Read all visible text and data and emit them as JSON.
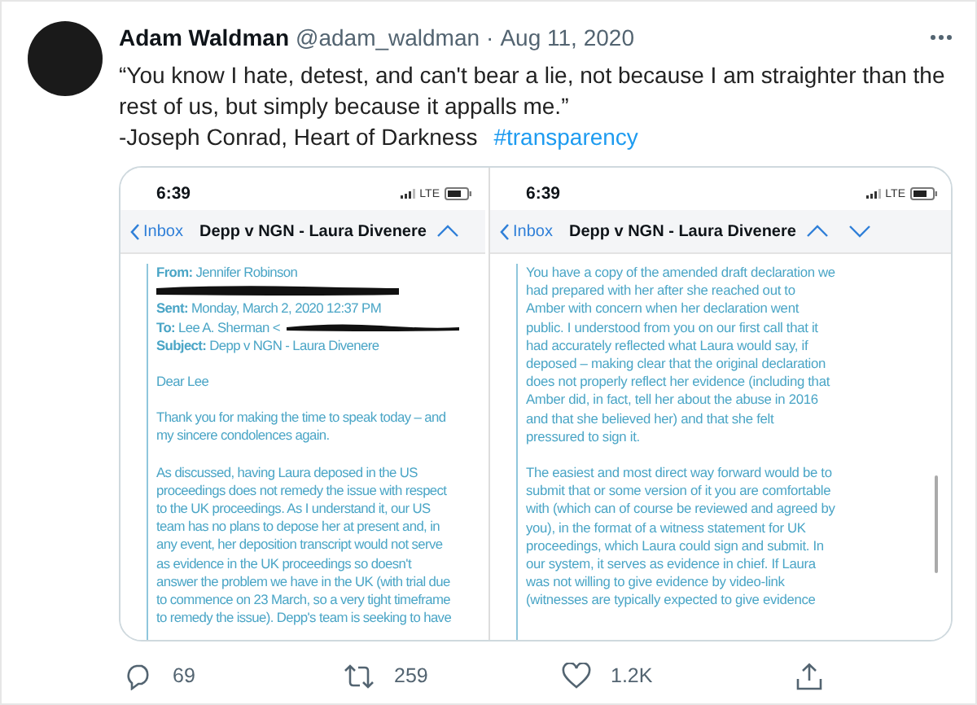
{
  "tweet": {
    "author": "Adam Waldman",
    "handle": "@adam_waldman",
    "separator": "·",
    "date": "Aug 11, 2020",
    "quote": "“You know I hate, detest, and can't bear a lie, not because I am straighter than the rest of us, but simply because it appalls me.”",
    "attribution": "-Joseph Conrad, Heart of Darkness",
    "hashtag": "#transparency"
  },
  "media": [
    {
      "time": "6:39",
      "carrier": "LTE",
      "back": "Inbox",
      "title": "Depp v NGN - Laura Divenere",
      "header": [
        {
          "kind": "field",
          "label": "From:",
          "value": "Jennifer Robinson",
          "redacted": false
        },
        {
          "kind": "redaction"
        },
        {
          "kind": "field",
          "label": "Sent:",
          "value": "Monday, March 2, 2020 12:37 PM",
          "redacted": false
        },
        {
          "kind": "field",
          "label": "To:",
          "value": "Lee A. Sherman <",
          "redacted": true
        },
        {
          "kind": "field",
          "label": "Subject:",
          "value": "Depp v NGN - Laura Divenere",
          "redacted": false
        }
      ],
      "paragraphs": [
        [
          "Dear Lee"
        ],
        [
          "Thank you for making the time to speak today – and",
          "my sincere condolences again."
        ],
        [
          "As discussed, having Laura deposed in the US",
          "proceedings does not remedy the issue with respect",
          "to the UK proceedings. As I understand it, our US",
          "team has no plans to depose her at present and, in",
          "any event, her deposition transcript would not serve",
          "as evidence in the UK proceedings so doesn't",
          "answer the problem we have in the UK (with trial due",
          "to commence on 23 March, so a very tight timeframe",
          "to remedy the issue). Depp's team is seeking to have"
        ]
      ]
    },
    {
      "time": "6:39",
      "carrier": "LTE",
      "back": "Inbox",
      "title": "Depp v NGN - Laura Divenere",
      "paragraphs": [
        [
          "You have a copy of the amended draft declaration we",
          "had prepared with her after she reached out to",
          "Amber with concern when her declaration went",
          "public. I understood from you on our first call that it",
          "had accurately reflected what Laura would say, if",
          "deposed – making clear that the original declaration",
          "does not properly reflect her evidence (including that",
          "Amber did, in fact, tell her about the abuse in 2016",
          "and that she believed her) and that she felt",
          "pressured to sign it."
        ],
        [
          "The easiest and most direct way forward would be to",
          "submit that or some version of it you are comfortable",
          "with (which can of course be reviewed and agreed by",
          "you), in the format of a witness statement for UK",
          "proceedings, which Laura could sign and submit. In",
          "our system, it serves as evidence in chief. If Laura",
          "was not willing to give evidence by video-link",
          "(witnesses are typically expected to give evidence"
        ]
      ]
    }
  ],
  "actions": [
    {
      "kind": "reply",
      "count": "69"
    },
    {
      "kind": "retweet",
      "count": "259"
    },
    {
      "kind": "like",
      "count": "1.2K"
    },
    {
      "kind": "share"
    }
  ]
}
